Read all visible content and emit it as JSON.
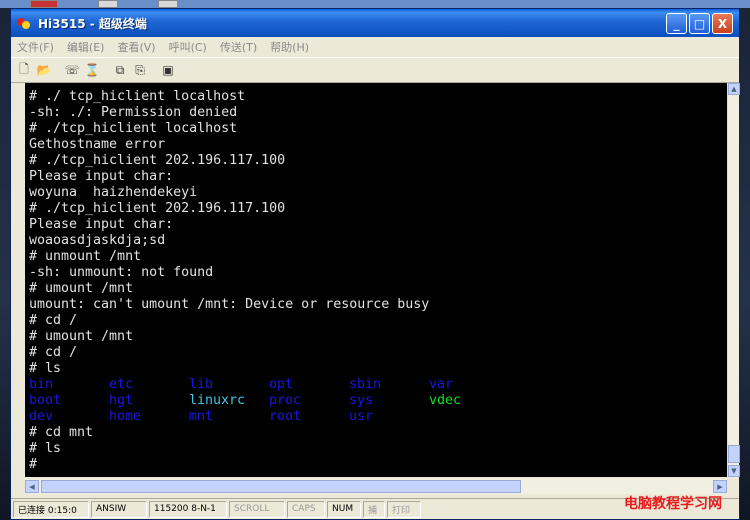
{
  "window": {
    "title": "Hi3515 - 超级终端",
    "minimize": "_",
    "maximize": "□",
    "close": "X"
  },
  "menu": [
    {
      "label": "文件(F)"
    },
    {
      "label": "编辑(E)"
    },
    {
      "label": "查看(V)"
    },
    {
      "label": "呼叫(C)"
    },
    {
      "label": "传送(T)"
    },
    {
      "label": "帮助(H)"
    }
  ],
  "toolbar": {
    "icons": [
      "new-icon",
      "open-icon",
      "disconnect-icon",
      "dial-icon",
      "send-icon",
      "receive-icon",
      "properties-icon"
    ]
  },
  "terminal": {
    "lines": [
      "# ./ tcp_hiclient localhost",
      "-sh: ./: Permission denied",
      "# ./tcp_hiclient localhost",
      "Gethostname error",
      "# ./tcp_hiclient 202.196.117.100",
      "Please input char:",
      "woyuna  haizhendekeyi",
      "# ./tcp_hiclient 202.196.117.100",
      "Please input char:",
      "woaoasdjaskdja;sd",
      "# unmount /mnt",
      "-sh: unmount: not found",
      "# umount /mnt",
      "umount: can't umount /mnt: Device or resource busy",
      "# cd /",
      "# umount /mnt",
      "# cd /",
      "# ls"
    ],
    "ls_rows": [
      [
        {
          "name": "bin",
          "color": "#1818e0"
        },
        {
          "name": "etc",
          "color": "#1818e0"
        },
        {
          "name": "lib",
          "color": "#1818e0"
        },
        {
          "name": "opt",
          "color": "#1818e0"
        },
        {
          "name": "sbin",
          "color": "#1818e0"
        },
        {
          "name": "var",
          "color": "#1818e0"
        }
      ],
      [
        {
          "name": "boot",
          "color": "#1818e0"
        },
        {
          "name": "hgt",
          "color": "#1818e0"
        },
        {
          "name": "linuxrc",
          "color": "#40c8e8"
        },
        {
          "name": "proc",
          "color": "#1818e0"
        },
        {
          "name": "sys",
          "color": "#1818e0"
        },
        {
          "name": "vdec",
          "color": "#10e020"
        }
      ],
      [
        {
          "name": "dev",
          "color": "#1818e0"
        },
        {
          "name": "home",
          "color": "#1818e0"
        },
        {
          "name": "mnt",
          "color": "#1818e0"
        },
        {
          "name": "root",
          "color": "#1818e0"
        },
        {
          "name": "usr",
          "color": "#1818e0"
        }
      ]
    ],
    "after_lines": [
      "# cd mnt",
      "# ls",
      "#"
    ]
  },
  "status": {
    "connected": "已连接 0:15:0",
    "emulation": "ANSIW",
    "settings": "115200 8-N-1",
    "scroll": "SCROLL",
    "caps": "CAPS",
    "num": "NUM",
    "capture": "捕",
    "print": "打印"
  },
  "watermark": "电脑教程学习网"
}
